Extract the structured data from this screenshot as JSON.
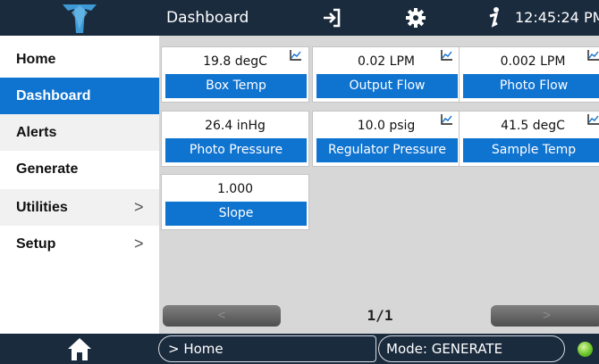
{
  "header": {
    "title": "Dashboard",
    "time": "12:45:24 PM",
    "icons": [
      "logo-icon",
      "exit-icon",
      "gear-icon",
      "info-icon"
    ]
  },
  "sidebar": {
    "items": [
      {
        "label": "Home",
        "chevron": ""
      },
      {
        "label": "Dashboard",
        "chevron": ""
      },
      {
        "label": "Alerts",
        "chevron": ""
      },
      {
        "label": "Generate",
        "chevron": ""
      },
      {
        "label": "Utilities",
        "chevron": ">"
      },
      {
        "label": "Setup",
        "chevron": ">"
      }
    ]
  },
  "tiles": [
    {
      "value": "19.8 degC",
      "label": "Box Temp",
      "chart_icon": true
    },
    {
      "value": "0.02 LPM",
      "label": "Output Flow",
      "chart_icon": true
    },
    {
      "value": "0.002 LPM",
      "label": "Photo Flow",
      "chart_icon": true
    },
    {
      "value": "26.4 inHg",
      "label": "Photo Pressure",
      "chart_icon": false
    },
    {
      "value": "10.0 psig",
      "label": "Regulator Pressure",
      "chart_icon": true
    },
    {
      "value": "41.5 degC",
      "label": "Sample Temp",
      "chart_icon": true
    },
    {
      "value": "1.000",
      "label": "Slope",
      "chart_icon": false
    }
  ],
  "pager": {
    "prev": "<",
    "page": "1/1",
    "next": ">"
  },
  "footer": {
    "breadcrumb": "> Home",
    "mode": "Mode: GENERATE",
    "status_color": "#6cc52a"
  },
  "colors": {
    "bar": "#1b2b3e",
    "accent": "#0f73d0",
    "main_bg": "#d7d7d7"
  }
}
